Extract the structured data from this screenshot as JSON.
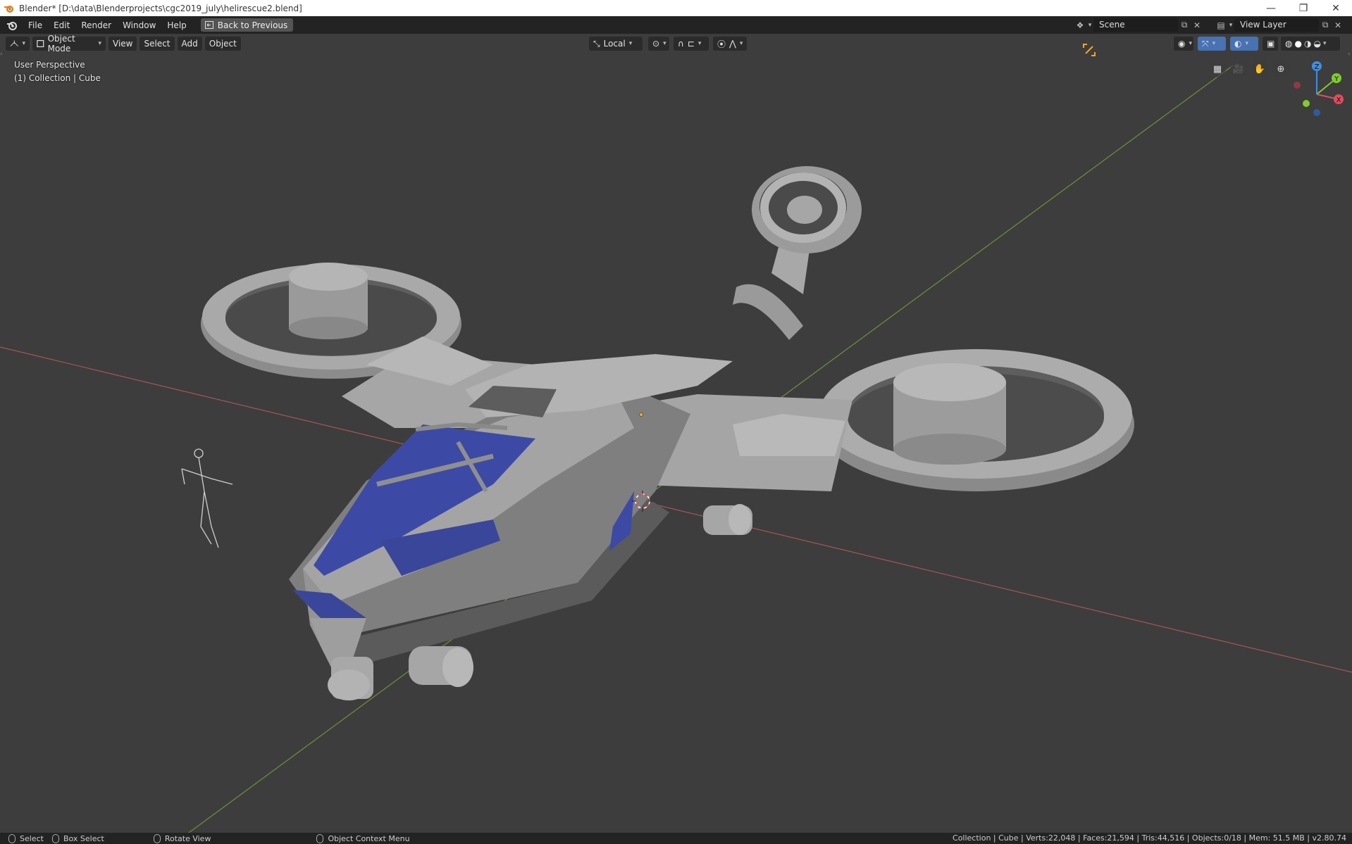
{
  "window": {
    "title": "Blender* [D:\\data\\Blenderprojects\\cgc2019_july\\helirescue2.blend]",
    "minimize": "—",
    "restore": "❐",
    "close": "✕"
  },
  "topbar": {
    "menus": [
      "File",
      "Edit",
      "Render",
      "Window",
      "Help"
    ],
    "back_label": "Back to Previous",
    "scene_value": "Scene",
    "view_layer_value": "View Layer"
  },
  "viewport_header": {
    "mode": "Object Mode",
    "menus": [
      "View",
      "Select",
      "Add",
      "Object"
    ],
    "transform_orientation": "Local"
  },
  "overlay": {
    "perspective": "User Perspective",
    "collection": "(1) Collection | Cube"
  },
  "gizmo": {
    "x": "X",
    "y": "Y",
    "z": "Z",
    "x_color": "#e04c5f",
    "y_color": "#7fcc2b",
    "z_color": "#3d8fe4"
  },
  "statusbar": {
    "select": "Select",
    "box_select": "Box Select",
    "rotate": "Rotate View",
    "context_menu": "Object Context Menu",
    "stats": "Collection | Cube | Verts:22,048 | Faces:21,594 | Tris:44,516 | Objects:0/18 | Mem: 51.5 MB | v2.80.74"
  },
  "colors": {
    "background": "#3d3d3d",
    "header": "#232323",
    "x_axis": "#c05a5a",
    "y_axis": "#7fa23a",
    "model": "#9a9a9a",
    "glass": "#3c4aa6",
    "accent": "#f5a623"
  }
}
